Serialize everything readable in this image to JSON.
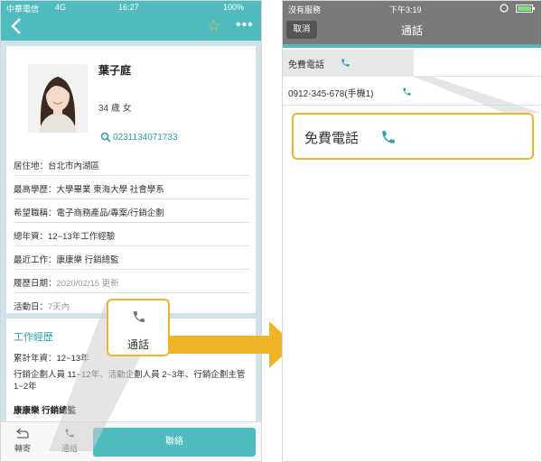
{
  "left": {
    "status": {
      "carrier": "中華電信",
      "network": "4G",
      "time": "16:27",
      "battery": "100%"
    },
    "profile": {
      "name": "葉子庭",
      "age_gender": "34 歲 女",
      "phone": "0231134071733",
      "rows": [
        {
          "label": "居住地：",
          "value": "台北市內湖區",
          "suffix": ""
        },
        {
          "label": "最高學歷：",
          "value": "大學畢業 東海大學 社會學系",
          "suffix": ""
        },
        {
          "label": "希望職稱：",
          "value": "電子商務產品/專案/行銷企劃",
          "suffix": ""
        },
        {
          "label": "總年資：",
          "value": "12~13年工作經驗",
          "suffix": ""
        },
        {
          "label": "最近工作：",
          "value": "康康樂 行銷總監",
          "suffix": ""
        },
        {
          "label": "履歷日期：",
          "value": "2020/02/15",
          "suffix": " 更新"
        },
        {
          "label": "活動日：",
          "value": "7天內",
          "suffix": ""
        }
      ]
    },
    "experience": {
      "title": "工作經歷",
      "total": "累計年資：12~13年",
      "summary": "行銷企劃人員 11~12年、活動企劃人員 2~3年、行銷企劃主管 1~2年",
      "latest": "康康樂 行銷總監"
    },
    "bottom": {
      "forward": "轉寄",
      "call": "通話",
      "contact": "聯絡"
    },
    "callout": {
      "label": "通話"
    }
  },
  "right": {
    "status": {
      "carrier": "沒有服務",
      "time": "下午3:19"
    },
    "nav": {
      "cancel": "取消",
      "title": "通話"
    },
    "options": [
      "免費電話",
      "0912-345-678(手機1)"
    ],
    "callout": {
      "label": "免費電話"
    }
  },
  "colors": {
    "teal": "#4fbdbf",
    "accent_teal": "#2aa3a6",
    "highlight_orange": "#f0b429",
    "grey_header": "#7a7a7a"
  }
}
